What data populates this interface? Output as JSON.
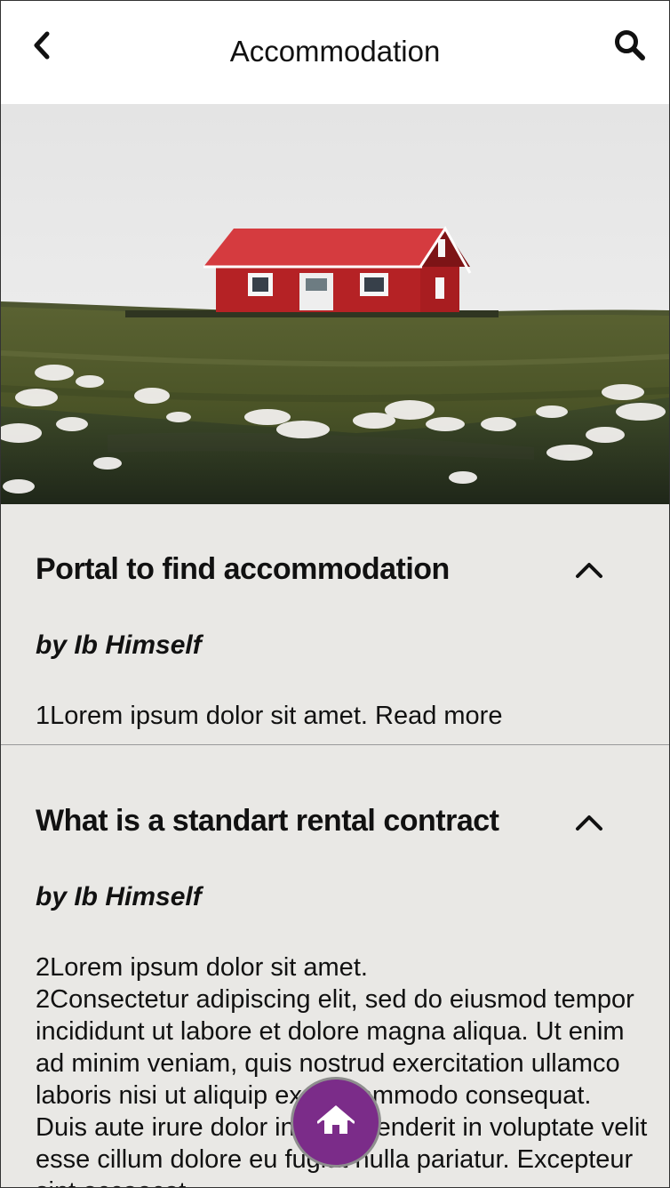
{
  "header": {
    "title": "Accommodation",
    "back_icon": "chevron-left-icon",
    "search_icon": "search-icon"
  },
  "hero": {
    "image": "red-house-on-grassy-hill-photo"
  },
  "articles": [
    {
      "title": "Portal to find accommodation",
      "author": "by Ib Himself",
      "body": "1Lorem ipsum dolor sit amet.",
      "read_more": "Read more",
      "toggle_icon": "chevron-up-icon"
    },
    {
      "title": "What is a standart rental contract",
      "author": "by Ib Himself",
      "body": "2Lorem ipsum dolor sit amet.\n2Consectetur adipiscing elit, sed do eiusmod tempor incididunt ut labore et dolore magna aliqua. Ut enim ad minim veniam, quis nostrud exercitation ullamco laboris nisi ut aliquip ex ea commodo consequat. Duis aute irure dolor in reprehenderit in voluptate velit esse cillum dolore eu fugiat nulla pariatur. Excepteur sint occaecat",
      "toggle_icon": "chevron-up-icon"
    }
  ],
  "fab": {
    "icon": "home-icon",
    "color": "#7b2c89"
  }
}
